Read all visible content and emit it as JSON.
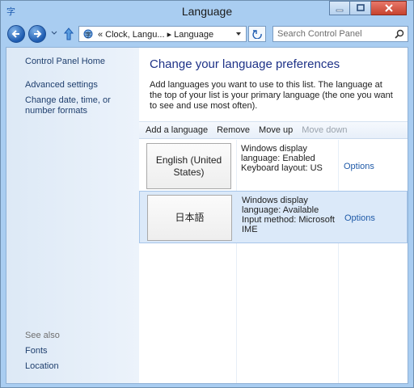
{
  "window": {
    "title": "Language"
  },
  "titlebar": {
    "buttons": [
      "minimize",
      "maximize",
      "close"
    ]
  },
  "nav": {
    "address_segments": "«  Clock, Langu... ▸ Language",
    "search_placeholder": "Search Control Panel"
  },
  "left_pane": {
    "home": "Control Panel Home",
    "advanced": "Advanced settings",
    "change_date": "Change date, time, or number formats",
    "see_also": "See also",
    "fonts": "Fonts",
    "location": "Location"
  },
  "main": {
    "heading": "Change your language preferences",
    "description": "Add languages you want to use to this list. The language at the top of your list is your primary language (the one you want to see and use most often)."
  },
  "toolbar": {
    "add": "Add a language",
    "remove": "Remove",
    "move_up": "Move up",
    "move_down": "Move down"
  },
  "languages": [
    {
      "name": "English (United States)",
      "info": "Windows display language: Enabled\nKeyboard layout: US",
      "options": "Options",
      "selected": false
    },
    {
      "name": "日本語",
      "info": "Windows display language: Available\nInput method: Microsoft IME",
      "options": "Options",
      "selected": true
    }
  ],
  "colors": {
    "chrome": "#a9cdf1",
    "heading": "#1e3287",
    "link": "#1f5aa8",
    "selection": "#dbe9f9"
  }
}
